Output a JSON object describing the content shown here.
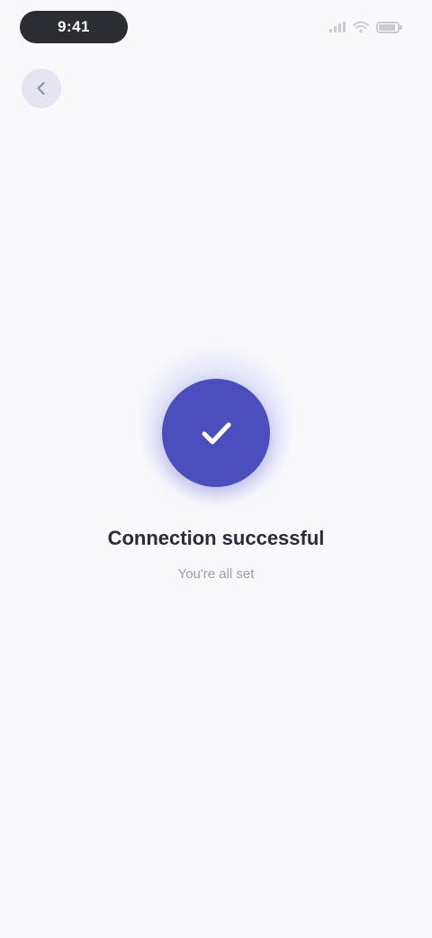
{
  "status_bar": {
    "time": "9:41",
    "icons": [
      "signal-icon",
      "wifi-icon",
      "battery-icon"
    ]
  },
  "navigation": {
    "back_icon": "arrow-left-icon"
  },
  "success": {
    "icon": "check-icon",
    "title": "Connection successful",
    "subtitle": "You're all set",
    "accent_color": "#4b4fbd"
  },
  "colors": {
    "background": "#f9f9fc",
    "accent": "#4b4fbd",
    "title_text": "#2a2c38",
    "subtitle_text": "#9a9cab"
  }
}
